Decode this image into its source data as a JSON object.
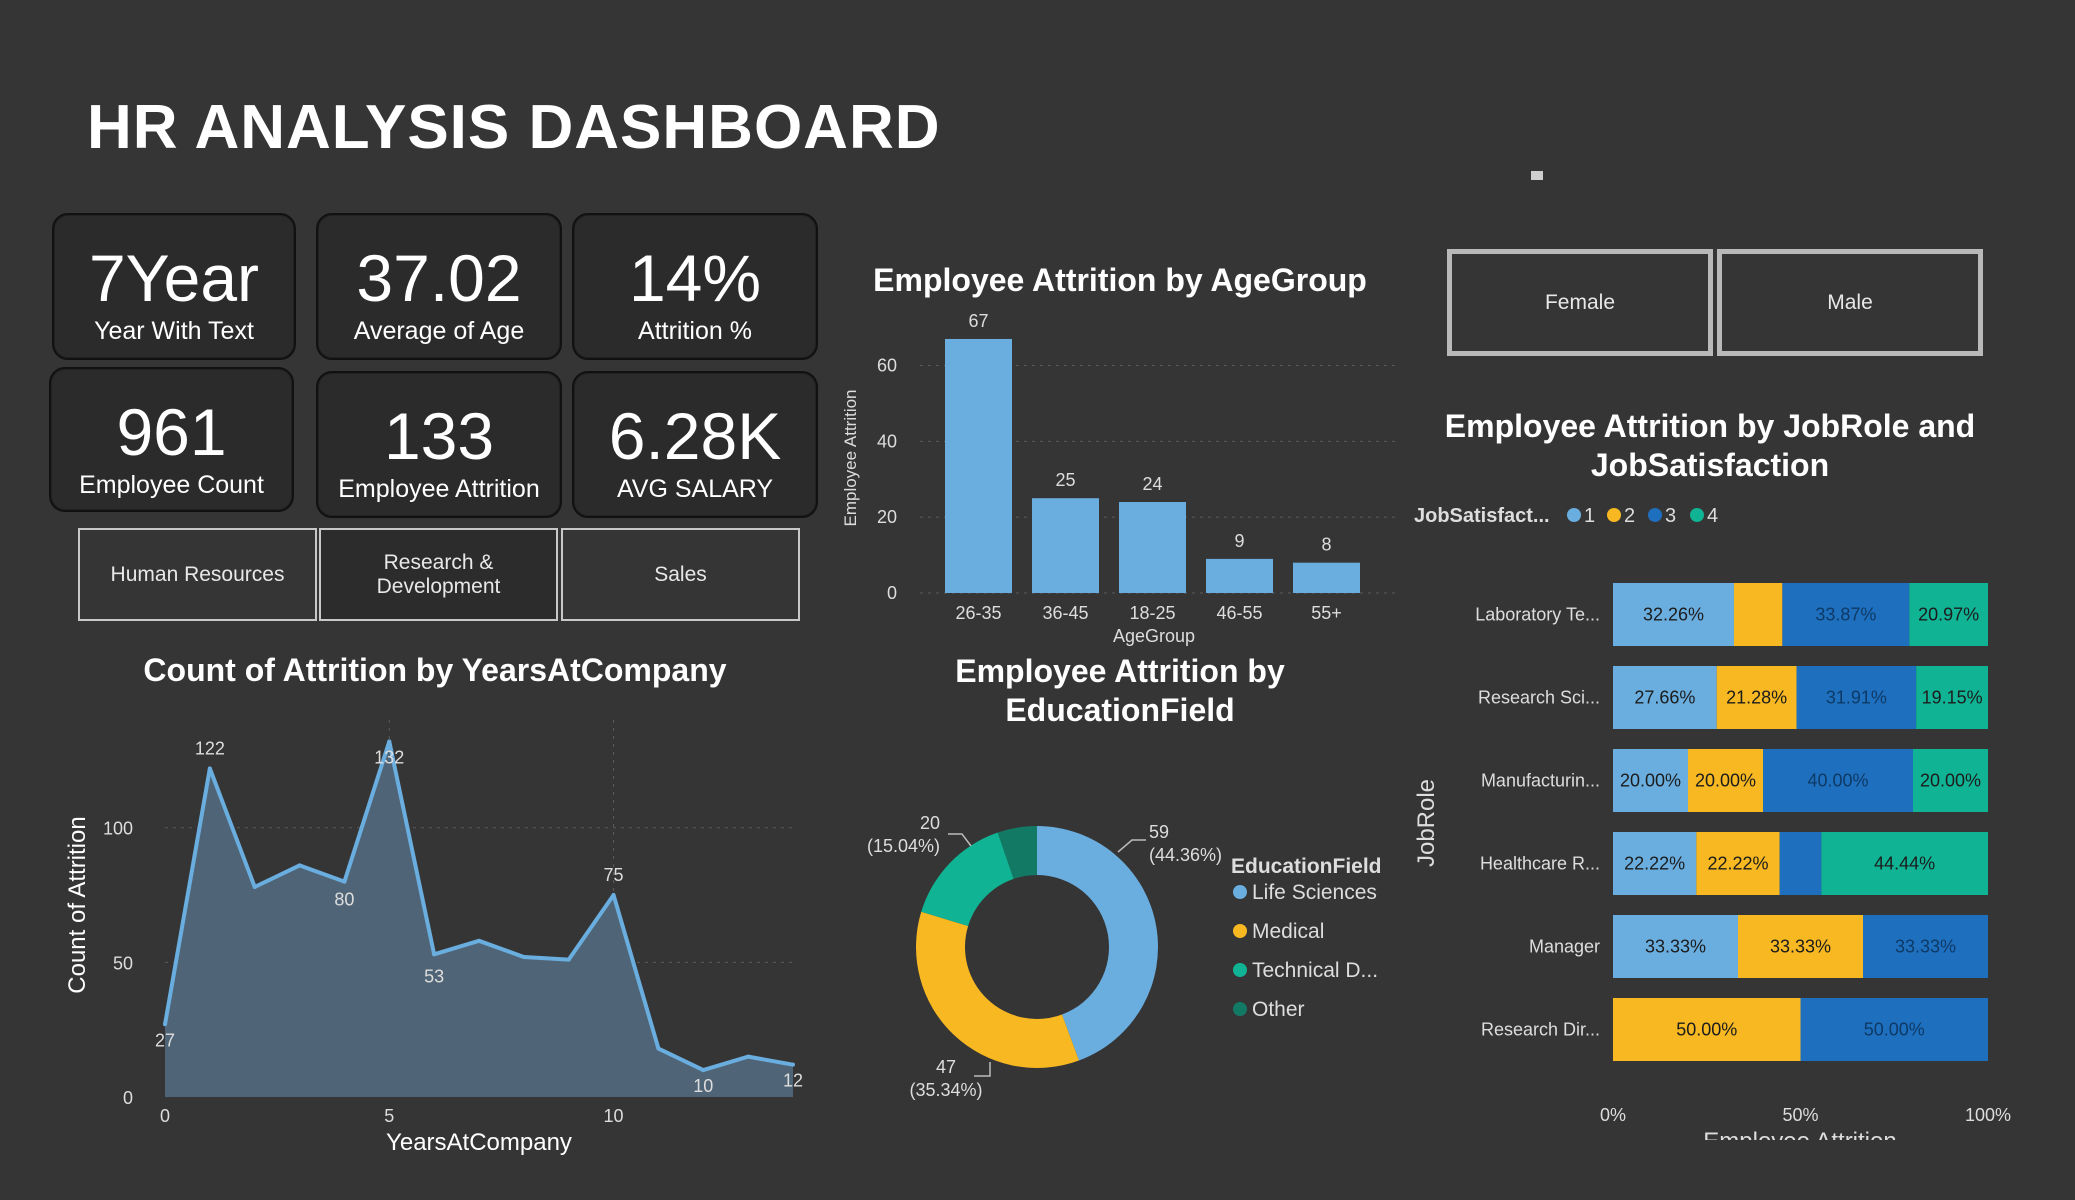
{
  "header": {
    "title": "HR ANALYSIS DASHBOARD"
  },
  "kpis": [
    {
      "value": "7Year",
      "label": "Year With Text"
    },
    {
      "value": "37.02",
      "label": "Average of Age"
    },
    {
      "value": "14%",
      "label": "Attrition %"
    },
    {
      "value": "961",
      "label": "Employee Count"
    },
    {
      "value": "133",
      "label": "Employee Attrition"
    },
    {
      "value": "6.28K",
      "label": "AVG SALARY"
    }
  ],
  "department_slicer": {
    "items": [
      "Human Resources",
      "Research & Development",
      "Sales"
    ],
    "selected": "Research & Development"
  },
  "gender_slicer": {
    "items": [
      "Female",
      "Male"
    ]
  },
  "colors": {
    "blue": "#6aaee0",
    "yellow": "#f7b822",
    "darkblue": "#1f6fbf",
    "teal": "#10b394",
    "darkteal": "#127a64",
    "area": "#4f6577"
  },
  "chart_data": [
    {
      "type": "area",
      "title": "Count of Attrition by YearsAtCompany",
      "xlabel": "YearsAtCompany",
      "ylabel": "Count of Attrition",
      "x": [
        0,
        1,
        2,
        3,
        4,
        5,
        6,
        7,
        8,
        9,
        10,
        11,
        12,
        13,
        14
      ],
      "values": [
        27,
        122,
        78,
        86,
        80,
        132,
        53,
        58,
        52,
        51,
        75,
        18,
        10,
        15,
        12
      ],
      "data_labels": {
        "0": "27",
        "1": "122",
        "4": "80",
        "5": "132",
        "6": "53",
        "10": "75",
        "12": "10",
        "14": "12"
      },
      "xticks": [
        "0",
        "5",
        "10"
      ],
      "yticks": [
        "0",
        "50",
        "100"
      ],
      "ylim": [
        0,
        140
      ],
      "grid": true
    },
    {
      "type": "bar",
      "title": "Employee Attrition by AgeGroup",
      "xlabel": "AgeGroup",
      "ylabel": "Employee Attrition",
      "categories": [
        "26-35",
        "36-45",
        "18-25",
        "46-55",
        "55+"
      ],
      "values": [
        67,
        25,
        24,
        9,
        8
      ],
      "yticks": [
        "0",
        "20",
        "40",
        "60"
      ],
      "ylim": [
        0,
        72
      ],
      "grid": true
    },
    {
      "type": "pie",
      "title": "Employee Attrition by EducationField",
      "legend_title": "EducationField",
      "categories": [
        "Life Sciences",
        "Medical",
        "Technical D...",
        "Other"
      ],
      "values": [
        59,
        47,
        20,
        7
      ],
      "labels": [
        {
          "count": "59",
          "pct": "(44.36%)"
        },
        {
          "count": "47",
          "pct": "(35.34%)"
        },
        {
          "count": "20",
          "pct": "(15.04%)"
        }
      ]
    },
    {
      "type": "bar",
      "orientation": "horizontal-100%-stacked",
      "title": "Employee Attrition by JobRole and JobSatisfaction",
      "legend_title": "JobSatisfact...",
      "series_names": [
        "1",
        "2",
        "3",
        "4"
      ],
      "xlabel": "Employee Attrition",
      "ylabel": "JobRole",
      "xticks": [
        "0%",
        "50%",
        "100%"
      ],
      "categories": [
        "Laboratory Te...",
        "Research Sci...",
        "Manufacturin...",
        "Healthcare R...",
        "Manager",
        "Research Dir..."
      ],
      "rows": [
        {
          "values": [
            32.26,
            12.9,
            33.87,
            20.97
          ],
          "labels": [
            "32.26%",
            "",
            "33.87%",
            "20.97%"
          ]
        },
        {
          "values": [
            27.66,
            21.28,
            31.91,
            19.15
          ],
          "labels": [
            "27.66%",
            "21.28%",
            "31.91%",
            "19.15%"
          ]
        },
        {
          "values": [
            20.0,
            20.0,
            40.0,
            20.0
          ],
          "labels": [
            "20.00%",
            "20.00%",
            "40.00%",
            "20.00%"
          ]
        },
        {
          "values": [
            22.22,
            22.22,
            11.11,
            44.44
          ],
          "labels": [
            "22.22%",
            "22.22%",
            "",
            "44.44%"
          ]
        },
        {
          "values": [
            33.33,
            33.33,
            33.33,
            0
          ],
          "labels": [
            "33.33%",
            "33.33%",
            "33.33%",
            ""
          ]
        },
        {
          "values": [
            0,
            50.0,
            50.0,
            0
          ],
          "labels": [
            "",
            "50.00%",
            "50.00%",
            ""
          ]
        }
      ]
    }
  ]
}
